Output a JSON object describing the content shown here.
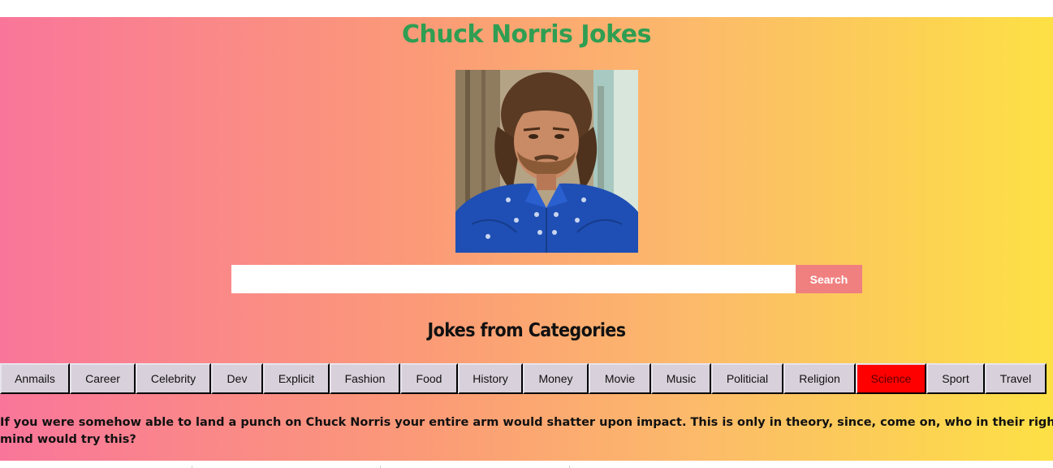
{
  "page": {
    "title": "Chuck Norris Jokes",
    "portrait_alt": "Chuck Norris photo"
  },
  "search": {
    "value": "",
    "placeholder": "",
    "button_label": "Search",
    "button_color": "#f08080"
  },
  "categories": {
    "heading": "Jokes from Categories",
    "active": "Science",
    "active_color": "#ff0000",
    "items": [
      {
        "label": "Anmails"
      },
      {
        "label": "Career"
      },
      {
        "label": "Celebrity"
      },
      {
        "label": "Dev"
      },
      {
        "label": "Explicit"
      },
      {
        "label": "Fashion"
      },
      {
        "label": "Food"
      },
      {
        "label": "History"
      },
      {
        "label": "Money"
      },
      {
        "label": "Movie"
      },
      {
        "label": "Music"
      },
      {
        "label": "Politicial"
      },
      {
        "label": "Religion"
      },
      {
        "label": "Science"
      },
      {
        "label": "Sport"
      },
      {
        "label": "Travel"
      }
    ]
  },
  "joke": {
    "text": "If you were somehow able to land a punch on Chuck Norris your entire arm would shatter upon impact. This is only in theory, since, come on, who in their right mind would try this?"
  },
  "colors": {
    "title": "#2f9e52",
    "gradient_start": "#f9769a",
    "gradient_end": "#fde045"
  }
}
